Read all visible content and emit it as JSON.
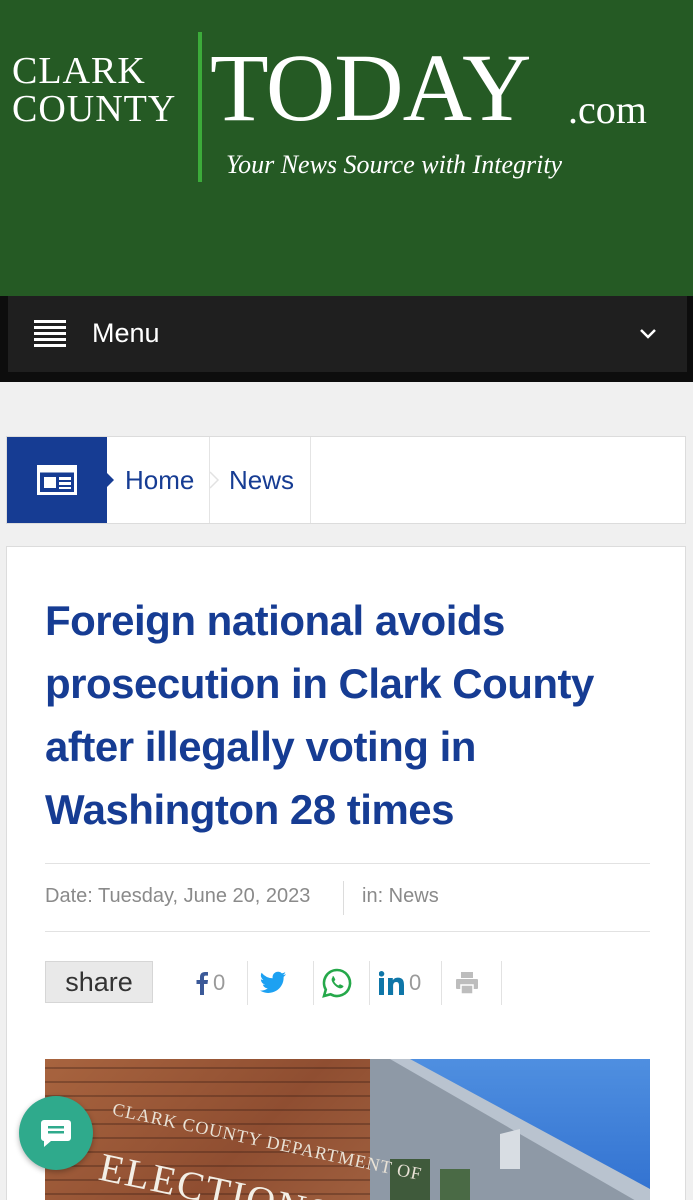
{
  "header": {
    "logo_line1": "CLARK",
    "logo_line2": "COUNTY",
    "logo_today": "TODAY",
    "logo_dotcom": ".com",
    "tagline": "Your News Source with Integrity"
  },
  "menu": {
    "label": "Menu",
    "menu_icon": "hamburger-icon",
    "expand_icon": "chevron-down-icon"
  },
  "breadcrumb": {
    "icon": "news-icon",
    "items": [
      {
        "label": "Home"
      },
      {
        "label": "News"
      }
    ]
  },
  "article": {
    "headline": "Foreign national avoids prosecution in Clark County after illegally voting in Washington 28 times",
    "date": "Date: Tuesday, June 20, 2023",
    "category": "in: News",
    "share_label": "share",
    "social": [
      {
        "icon": "facebook-icon",
        "count": "0"
      },
      {
        "icon": "twitter-icon"
      },
      {
        "icon": "whatsapp-icon"
      },
      {
        "icon": "linkedin-icon",
        "count": "0"
      },
      {
        "icon": "print-icon"
      }
    ],
    "image": {
      "sign_line1": "CLARK COUNTY DEPARTMENT OF",
      "sign_line2": "ELECTIONS"
    }
  },
  "chat": {
    "icon": "chat-icon"
  },
  "colors": {
    "header_bg": "#255a24",
    "logo_divider": "#3cab3a",
    "menu_bg": "#1f1f1f",
    "brand_blue": "#163c93",
    "chat_green": "#2faa8c"
  }
}
